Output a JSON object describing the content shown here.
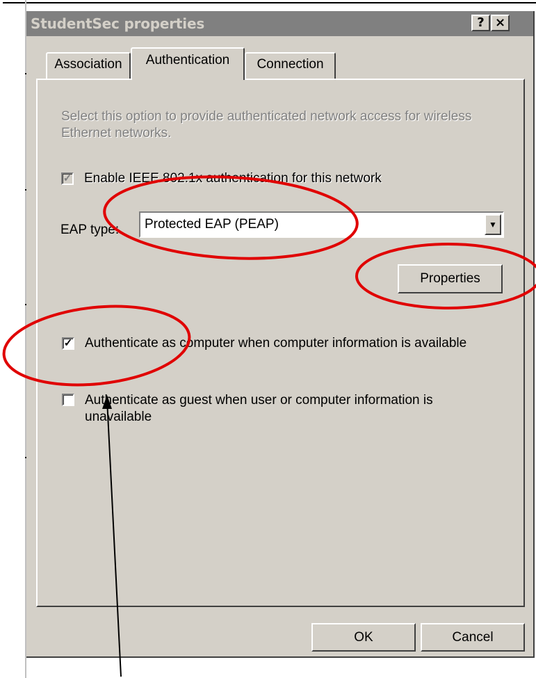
{
  "window": {
    "title": "StudentSec properties",
    "help_label": "?",
    "close_label": "×"
  },
  "tabs": [
    {
      "label": "Association",
      "active": false
    },
    {
      "label": "Authentication",
      "active": true
    },
    {
      "label": "Connection",
      "active": false
    }
  ],
  "panel": {
    "description": "Select this option to provide authenticated network access for wireless Ethernet networks.",
    "enable_8021x": {
      "label": "Enable IEEE 802.1x authentication for this network",
      "checked": true,
      "disabled": true,
      "mark": "✓"
    },
    "eap_type": {
      "label": "EAP type:",
      "value": "Protected EAP (PEAP)",
      "arrow": "▼"
    },
    "properties_label": "Properties",
    "auth_computer": {
      "label": "Authenticate as computer when computer information is available",
      "checked": true,
      "mark": "✓"
    },
    "auth_guest": {
      "label": "Authenticate as guest when user or computer information is unavailable",
      "checked": false,
      "mark": ""
    }
  },
  "footer": {
    "ok_label": "OK",
    "cancel_label": "Cancel"
  },
  "colors": {
    "annotation_red": "#e00000",
    "dialog_face": "#d4d0c8",
    "titlebar_inactive": "#808080"
  }
}
